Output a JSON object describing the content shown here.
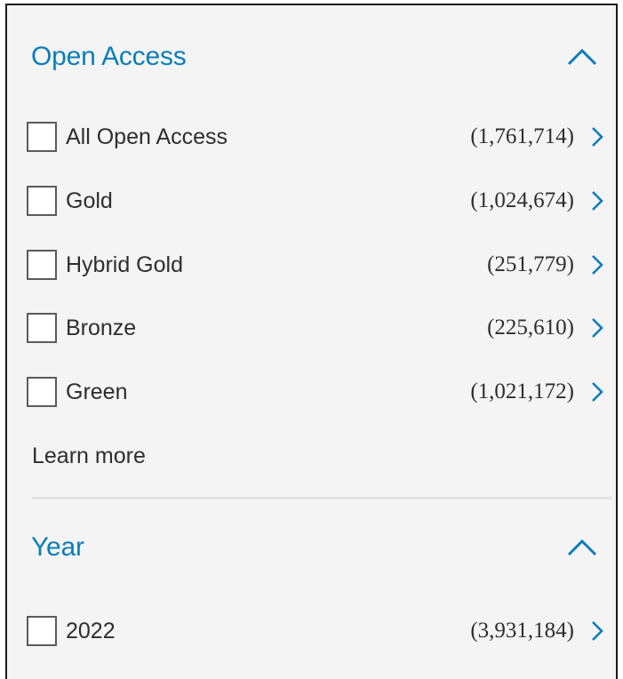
{
  "colors": {
    "accent": "#0c7dbb",
    "text": "#2e2e2e",
    "panel_bg": "#f4f4f4"
  },
  "icons": {
    "collapse": "chevron-up-icon",
    "expand_row": "chevron-right-icon"
  },
  "open_access": {
    "title": "Open Access",
    "items": [
      {
        "label": "All Open Access",
        "count": "(1,761,714)",
        "checked": false
      },
      {
        "label": "Gold",
        "count": "(1,024,674)",
        "checked": false
      },
      {
        "label": "Hybrid Gold",
        "count": "(251,779)",
        "checked": false
      },
      {
        "label": "Bronze",
        "count": "(225,610)",
        "checked": false
      },
      {
        "label": "Green",
        "count": "(1,021,172)",
        "checked": false
      }
    ],
    "learn_more": "Learn more"
  },
  "year": {
    "title": "Year",
    "items": [
      {
        "label": "2022",
        "count": "(3,931,184)",
        "checked": false
      }
    ]
  }
}
